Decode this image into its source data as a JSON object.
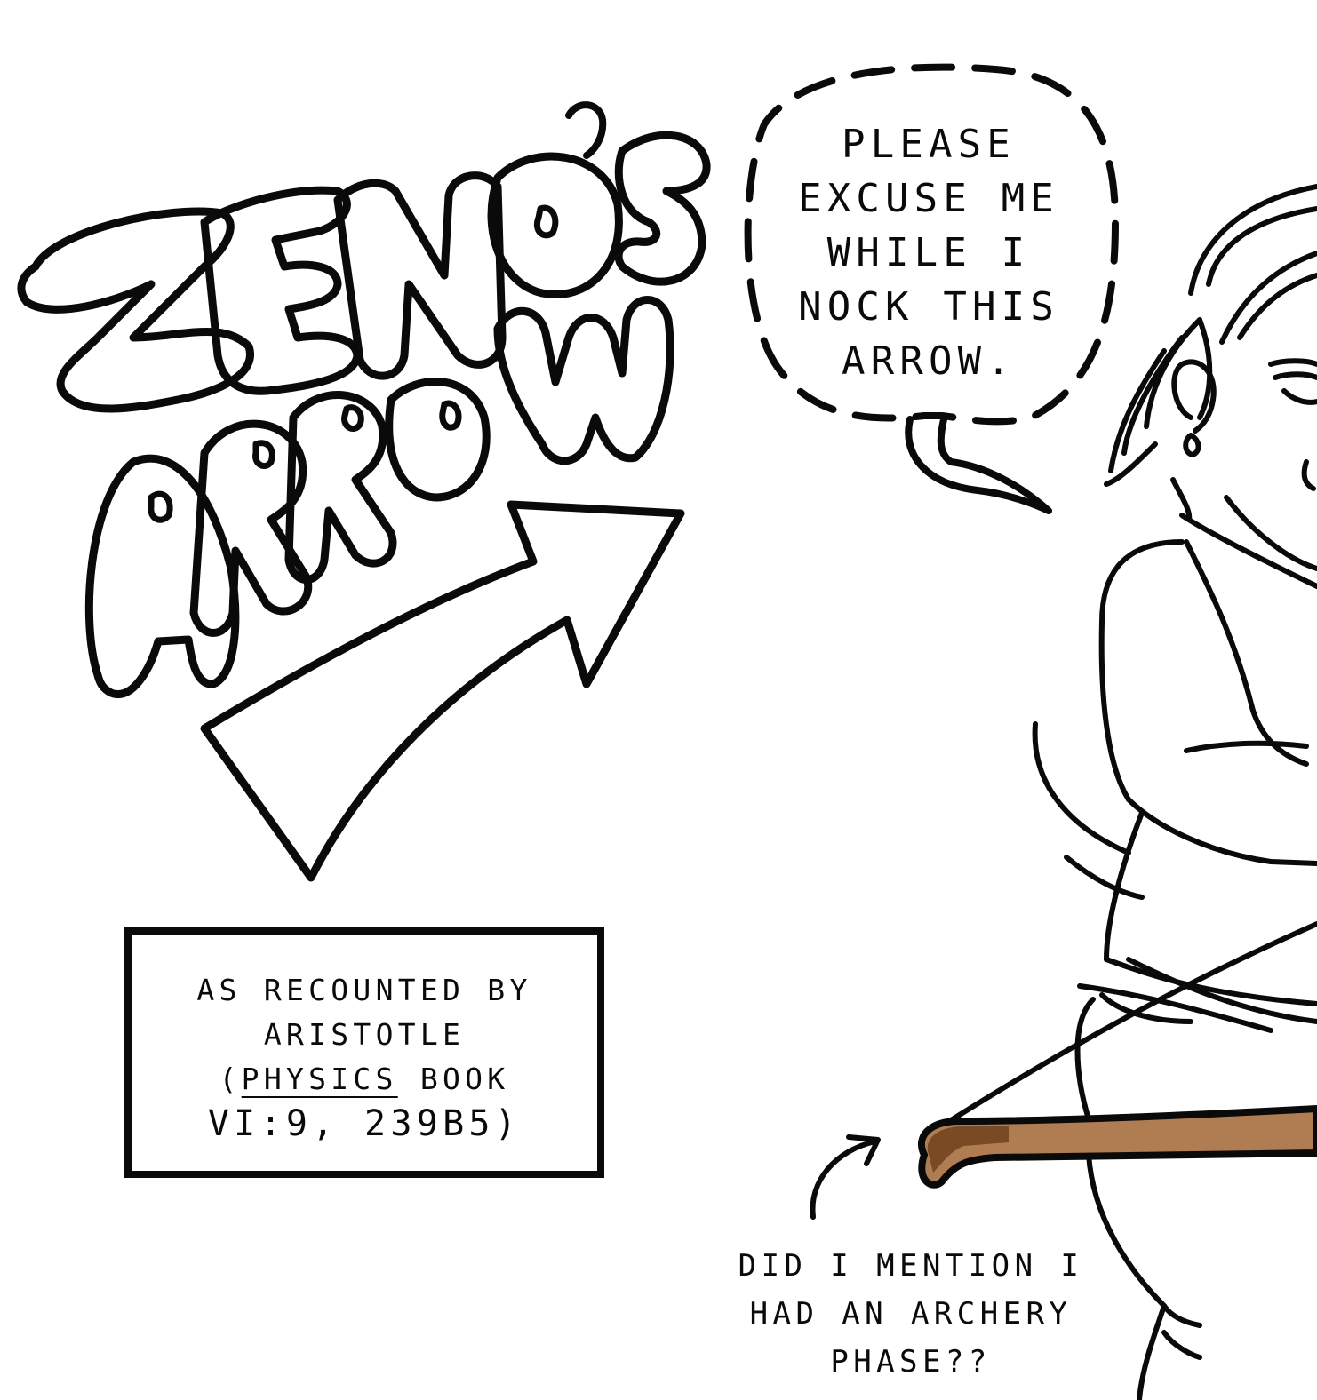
{
  "title": {
    "line1": "ZENO'S",
    "line2": "ARROW"
  },
  "speech_bubble": {
    "lines": [
      "PLEASE",
      "EXCUSE ME",
      "WHILE I",
      "NOCK THIS",
      "ARROW."
    ]
  },
  "caption": {
    "line1": "AS RECOUNTED BY",
    "line2": "ARISTOTLE",
    "line3_open": "(",
    "line3_work": "PHYSICS",
    "line3_rest": " BOOK",
    "line4": "VI:9, 239B5)"
  },
  "side_note": {
    "lines": [
      "DID I MENTION I",
      "HAD AN ARCHERY",
      "PHASE??"
    ]
  },
  "colors": {
    "ink": "#0a0a0a",
    "paper": "#ffffff",
    "bow_wood": "#b07d52",
    "bow_tip": "#7a4a24"
  },
  "icons": [
    "title-lettering-art",
    "big-arrow-icon",
    "small-arrow-icon",
    "archer-figure",
    "bow-icon"
  ]
}
